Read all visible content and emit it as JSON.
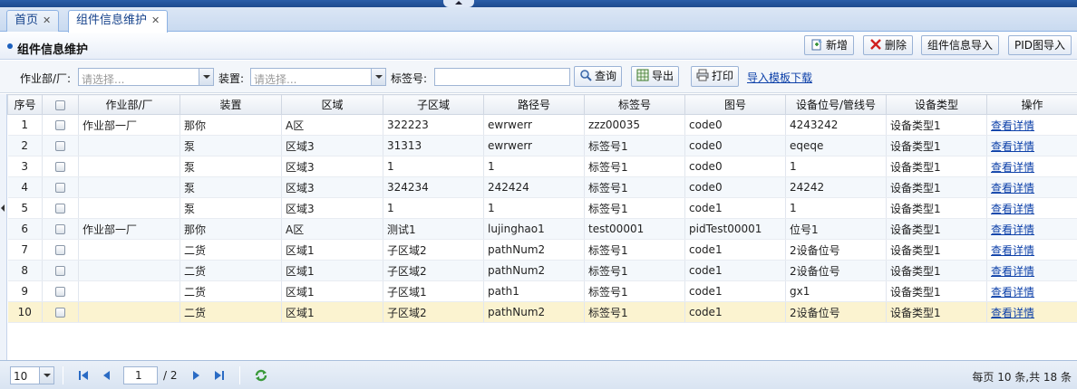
{
  "tabs": [
    {
      "label": "首页",
      "close": "✕"
    },
    {
      "label": "组件信息维护",
      "close": "✕"
    }
  ],
  "panel": {
    "title": "组件信息维护"
  },
  "toolbar": {
    "add": "新增",
    "delete": "删除",
    "import_component": "组件信息导入",
    "import_pid": "PID图导入"
  },
  "search": {
    "dept_label": "作业部/厂:",
    "dept_placeholder": "请选择...",
    "device_label": "装置:",
    "device_placeholder": "请选择...",
    "tag_label": "标签号:",
    "tag_value": "",
    "query": "查询",
    "export": "导出",
    "print": "打印",
    "template": "导入模板下载"
  },
  "grid": {
    "columns": [
      "序号",
      "",
      "作业部/厂",
      "装置",
      "区域",
      "子区域",
      "路径号",
      "标签号",
      "图号",
      "设备位号/管线号",
      "设备类型",
      "操作"
    ],
    "action_label": "查看详情",
    "rows": [
      [
        "1",
        "作业部一厂",
        "那你",
        "A区",
        "322223",
        "ewrwerr",
        "zzz00035",
        "code0",
        "4243242",
        "设备类型1"
      ],
      [
        "2",
        "",
        "泵",
        "区域3",
        "31313",
        "ewrwerr",
        "标签号1",
        "code0",
        "eqeqe",
        "设备类型1"
      ],
      [
        "3",
        "",
        "泵",
        "区域3",
        "1",
        "1",
        "标签号1",
        "code0",
        "1",
        "设备类型1"
      ],
      [
        "4",
        "",
        "泵",
        "区域3",
        "324234",
        "242424",
        "标签号1",
        "code0",
        "24242",
        "设备类型1"
      ],
      [
        "5",
        "",
        "泵",
        "区域3",
        "1",
        "1",
        "标签号1",
        "code1",
        "1",
        "设备类型1"
      ],
      [
        "6",
        "作业部一厂",
        "那你",
        "A区",
        "测试1",
        "lujinghao1",
        "test00001",
        "pidTest00001",
        "位号1",
        "设备类型1"
      ],
      [
        "7",
        "",
        "二货",
        "区域1",
        "子区域2",
        "pathNum2",
        "标签号1",
        "code1",
        "2设备位号",
        "设备类型1"
      ],
      [
        "8",
        "",
        "二货",
        "区域1",
        "子区域2",
        "pathNum2",
        "标签号1",
        "code1",
        "2设备位号",
        "设备类型1"
      ],
      [
        "9",
        "",
        "二货",
        "区域1",
        "子区域1",
        "path1",
        "标签号1",
        "code1",
        "gx1",
        "设备类型1"
      ],
      [
        "10",
        "",
        "二货",
        "区域1",
        "子区域2",
        "pathNum2",
        "标签号1",
        "code1",
        "2设备位号",
        "设备类型1"
      ]
    ],
    "selected_row": 10
  },
  "pager": {
    "page_size": "10",
    "current_page": "1",
    "total_pages": "/ 2",
    "info": "每页 10 条,共 18 条"
  }
}
